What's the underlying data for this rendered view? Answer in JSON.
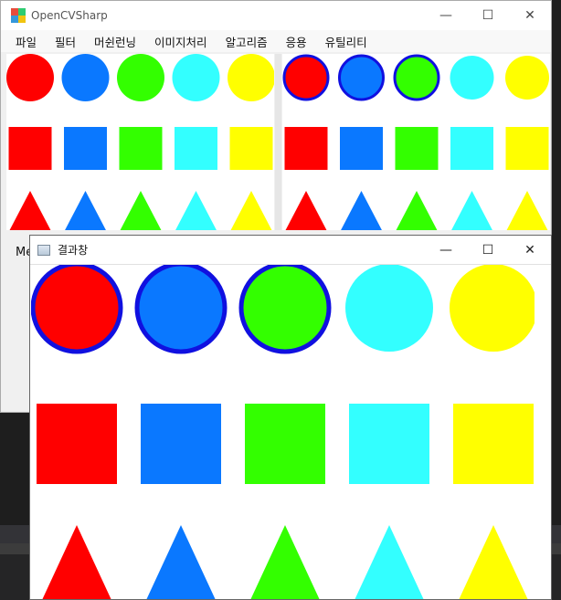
{
  "main_window": {
    "title": "OpenCVSharp",
    "controls": {
      "minimize": "—",
      "maximize": "☐",
      "close": "✕"
    },
    "menu": [
      "파일",
      "필터",
      "머쉰런닝",
      "이미지처리",
      "알고리즘",
      "응용",
      "유틸리티"
    ],
    "label_partial": "Me"
  },
  "result_window": {
    "title": "결과창",
    "controls": {
      "minimize": "—",
      "maximize": "☐",
      "close": "✕"
    }
  },
  "colors": {
    "red": "#ff0000",
    "blue": "#0a78ff",
    "green": "#33ff00",
    "cyan": "#33ffff",
    "yellow": "#ffff00",
    "outline": "#1010e0"
  },
  "shapes": {
    "rows": [
      "circle",
      "square",
      "triangle"
    ],
    "columns": [
      "red",
      "blue",
      "green",
      "cyan",
      "yellow"
    ],
    "outlined_circles_in_result": [
      "red",
      "blue",
      "green"
    ]
  }
}
